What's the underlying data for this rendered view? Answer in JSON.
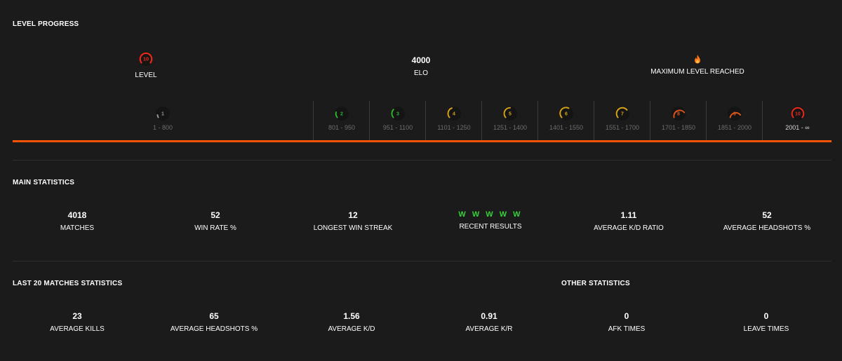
{
  "level_progress": {
    "title": "LEVEL PROGRESS",
    "level": {
      "value": "10",
      "label": "LEVEL"
    },
    "elo": {
      "value": "4000",
      "label": "ELO"
    },
    "max": {
      "label": "MAXIMUM LEVEL REACHED",
      "icon": "flame-icon"
    },
    "levels": [
      {
        "num": "1",
        "range": "1 - 800",
        "color": "#9a9a9a"
      },
      {
        "num": "2",
        "range": "801 - 950",
        "color": "#2fb22f"
      },
      {
        "num": "3",
        "range": "951 - 1100",
        "color": "#2fb22f"
      },
      {
        "num": "4",
        "range": "1101 - 1250",
        "color": "#d6a21a"
      },
      {
        "num": "5",
        "range": "1251 - 1400",
        "color": "#d6a21a"
      },
      {
        "num": "6",
        "range": "1401 - 1550",
        "color": "#d6a21a"
      },
      {
        "num": "7",
        "range": "1551 - 1700",
        "color": "#d6a21a"
      },
      {
        "num": "8",
        "range": "1701 - 1850",
        "color": "#d9541a"
      },
      {
        "num": "9",
        "range": "1851 - 2000",
        "color": "#d9541a"
      },
      {
        "num": "10",
        "range": "2001 - ∞",
        "color": "#e8291c"
      }
    ],
    "accent_color": "#ff5500"
  },
  "main_statistics": {
    "title": "MAIN STATISTICS",
    "items": [
      {
        "value": "4018",
        "label": "MATCHES"
      },
      {
        "value": "52",
        "label": "WIN RATE %"
      },
      {
        "value": "12",
        "label": "LONGEST WIN STREAK"
      },
      {
        "value": "W W W W W",
        "label": "RECENT RESULTS"
      },
      {
        "value": "1.11",
        "label": "AVERAGE K/D RATIO"
      },
      {
        "value": "52",
        "label": "AVERAGE HEADSHOTS %"
      }
    ]
  },
  "last20": {
    "title": "LAST 20 MATCHES STATISTICS",
    "items": [
      {
        "value": "23",
        "label": "AVERAGE KILLS"
      },
      {
        "value": "65",
        "label": "AVERAGE HEADSHOTS %"
      },
      {
        "value": "1.56",
        "label": "AVERAGE K/D"
      },
      {
        "value": "0.91",
        "label": "AVERAGE K/R"
      }
    ]
  },
  "other": {
    "title": "OTHER STATISTICS",
    "items": [
      {
        "value": "0",
        "label": "AFK TIMES"
      },
      {
        "value": "0",
        "label": "LEAVE TIMES"
      }
    ]
  }
}
